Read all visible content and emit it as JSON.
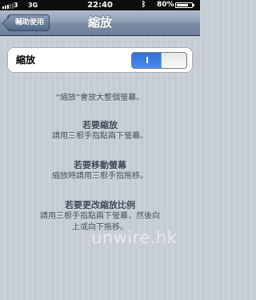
{
  "status_bar": {
    "carrier": "3",
    "network": "3G",
    "time": "22:40",
    "battery_percent": "80%",
    "battery_level": 0.8,
    "icons": [
      "signal-bars-icon",
      "bluetooth-icon",
      "battery-icon"
    ]
  },
  "nav": {
    "back_label": "輔助使用",
    "title": "縮放"
  },
  "setting": {
    "label": "縮放",
    "toggle_on_text": "I",
    "toggle_state": "on"
  },
  "content": {
    "intro": "“縮放”會放大整個螢幕。",
    "sections": [
      {
        "heading": "若要縮放",
        "lines": [
          "請用三根手指點兩下螢幕。"
        ]
      },
      {
        "heading": "若要移動螢幕",
        "lines": [
          "縮放時請用三根手指拖移。"
        ]
      },
      {
        "heading": "若要更改縮放比例",
        "lines": [
          "請用三根手指點兩下螢幕，然後向",
          "上或向下拖移。"
        ]
      }
    ]
  },
  "watermark": "unwire.hk",
  "colors": {
    "nav_bar": "#8a9bb3",
    "background": "#c5ccd4",
    "toggle_on": "#3a7ce3",
    "text": "#3c4555"
  }
}
